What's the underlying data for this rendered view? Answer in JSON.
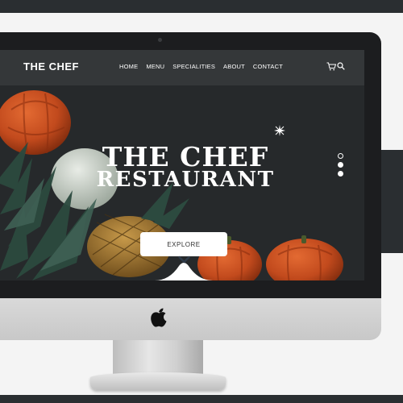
{
  "site": {
    "logo": "THE CHEF",
    "nav": [
      "HOME",
      "MENU",
      "SPECIALITIES",
      "ABOUT",
      "CONTACT"
    ],
    "icons": [
      "cart-icon",
      "search-icon"
    ]
  },
  "hero": {
    "title": "THE CHEF",
    "subtitle": "RESTAURANT",
    "cta_label": "EXPLORE",
    "slides": {
      "total": 3,
      "active": 1
    }
  },
  "colors": {
    "navbar_bg": "#343739",
    "hero_bg": "#26292b",
    "text": "#ffffff",
    "chevron": "#2f3b4a"
  }
}
